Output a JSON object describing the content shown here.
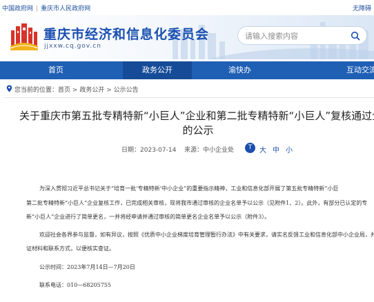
{
  "topbar": {
    "gov_link": "中国政府网",
    "city_link": "重庆市人民政府网",
    "accessibility": "无障碍"
  },
  "header": {
    "site_title": "重庆市经济和信息化委员会",
    "site_url": "jjxxw.cq.gov.cn",
    "search_placeholder": "请输入搜索内容"
  },
  "nav": {
    "items": [
      {
        "label": "首页"
      },
      {
        "label": "政务公开"
      },
      {
        "label": "渝快办"
      },
      {
        "label": "互动交流"
      }
    ]
  },
  "breadcrumb": {
    "prefix": "您当前的位置：",
    "home": "首页",
    "sep": ">",
    "level1": "政务公开",
    "level2": "公示公告"
  },
  "article": {
    "title_line1": "关于重庆市第五批专精特新“小巨人”企业和第二批专精特新“小巨人”复核通过企",
    "title_line2": "的公示",
    "date_label": "日期：",
    "date": "2023-07-14",
    "source_label": "来源：",
    "source": "中小企业处",
    "font_size_big": "大",
    "font_size_mid": "中",
    "font_size_small": "小",
    "p1_l1": "为深入贯彻习近平总书记关于“培育一批‘专精特新’中小企业”的重要指示精神，工业和信息化部开展了第五批专精特新“小巨",
    "p1_l2": "第二批专精特新“小巨人”企业复核工作，已完成相关审核，现将我市通过审核的企业名单予以公示（见附件1、2）。此外，有部分已认定的专",
    "p1_l3": "新“小巨人”企业进行了简单更名，一并将经申请并通过审核的简单更名企业名单予以公示（附件3）。",
    "p2_l1": "欢迎社会各界参与监督，如有异议，按照《优质中小企业梯度培育管理暂行办法》中有关要求，请实名反馈工业和信息化部中小企业局，并",
    "p2_l2": "证材料和联系方式，以便核实查证。",
    "period": "公示时间：2023年7月14日—7月20日",
    "phone": "联系电话：010—68205755"
  },
  "colors": {
    "brand_blue": "#1a4fb0",
    "nav_blue": "#1f5fb4",
    "logo_red": "#d7332a",
    "logo_yellow": "#f2b21b"
  }
}
